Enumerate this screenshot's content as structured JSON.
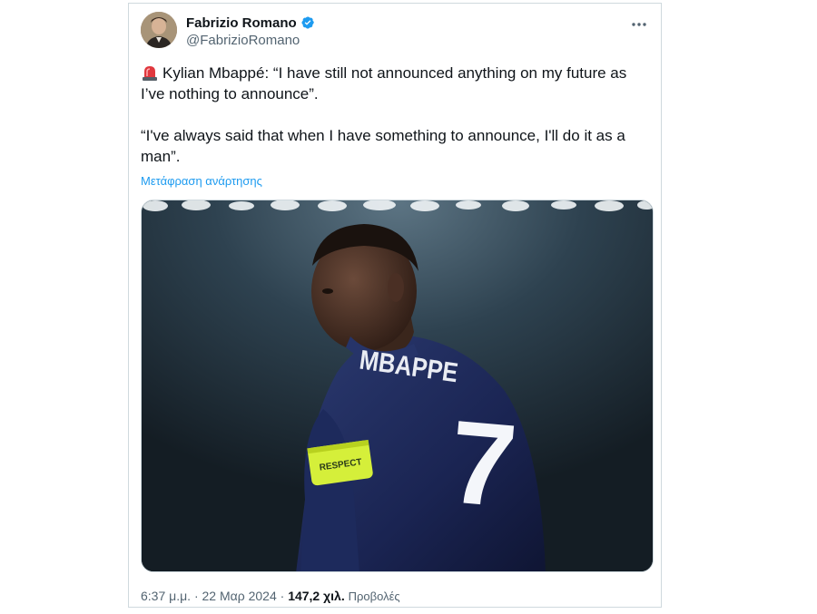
{
  "tweet": {
    "author": {
      "display_name": "Fabrizio Romano",
      "handle": "@FabrizioRomano",
      "verified": true,
      "verified_badge_color": "#1d9bf0"
    },
    "more_icon": "more-horizontal-icon",
    "emoji": "police-car-light-icon",
    "text_line_1": "Kylian Mbappé: “I have still not announced anything on my future as I’ve nothing to announce”.",
    "text_line_2": "“I've always said that when I have something to announce, I'll do it as a man”.",
    "translate_label": "Μετάφραση ανάρτησης",
    "media": {
      "type": "photo",
      "jersey_name": "MBAPPE",
      "jersey_number": "7",
      "armband_text": "RESPECT"
    },
    "time": "6:37 μ.μ.",
    "separator": "·",
    "date": "22 Μαρ 2024",
    "separator_2": "·",
    "views_count": "147,2 χιλ.",
    "views_label": "Προβολές"
  },
  "colors": {
    "link": "#1d9bf0",
    "text_primary": "#0f1419",
    "text_secondary": "#536471",
    "border": "#cfd9de"
  }
}
